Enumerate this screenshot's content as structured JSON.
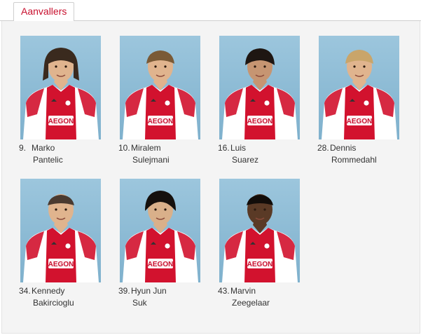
{
  "tab": {
    "label": "Aanvallers"
  },
  "colors": {
    "accent": "#c8102e",
    "panel": "#f4f4f4",
    "photo_bg": "#8fbdd6"
  },
  "players": [
    {
      "number": "9.",
      "first": "Marko",
      "last": "Pantelic",
      "hair": "long"
    },
    {
      "number": "10.",
      "first": "Miralem",
      "last": "Sulejmani",
      "hair": "short"
    },
    {
      "number": "16.",
      "first": "Luis",
      "last": "Suarez",
      "hair": "short-dark"
    },
    {
      "number": "28.",
      "first": "Dennis",
      "last": "Rommedahl",
      "hair": "blond"
    },
    {
      "number": "34.",
      "first": "Kennedy",
      "last": "Bakircioglu",
      "hair": "buzz"
    },
    {
      "number": "39.",
      "first": "Hyun Jun",
      "last": "Suk",
      "hair": "medium-dark"
    },
    {
      "number": "43.",
      "first": "Marvin",
      "last": "Zeegelaar",
      "hair": "buzz-dark"
    }
  ]
}
